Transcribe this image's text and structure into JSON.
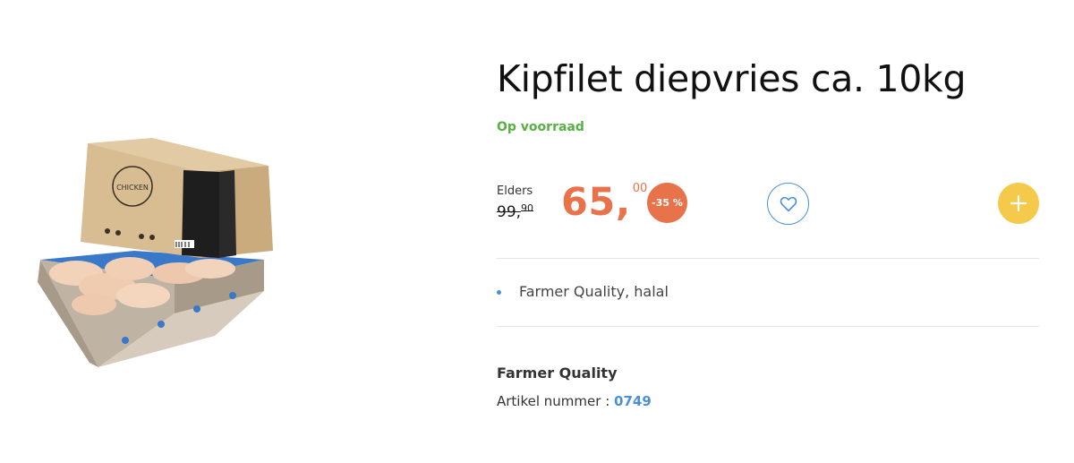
{
  "product": {
    "title": "Kipfilet diepvries ca. 10kg",
    "stock_status": "Op voorraad",
    "image_alt": "Kipfilet diepvries doos",
    "box_label": "CHICKEN"
  },
  "pricing": {
    "elsewhere_label": "Elders",
    "old_price_main": "99,",
    "old_price_cents": "90",
    "price_euros": "65,",
    "price_cents": "00",
    "discount": "-35 %"
  },
  "actions": {
    "wishlist_icon": "heart-icon",
    "add_icon": "plus-icon"
  },
  "features": [
    "Farmer Quality, halal"
  ],
  "info": {
    "brand": "Farmer Quality",
    "article_label": "Artikel nummer : ",
    "article_number": "0749"
  },
  "colors": {
    "title": "#111111",
    "stock": "#57b143",
    "price_accent": "#e8734a",
    "link_blue": "#4a90d9",
    "cart_yellow": "#f5c94a"
  }
}
